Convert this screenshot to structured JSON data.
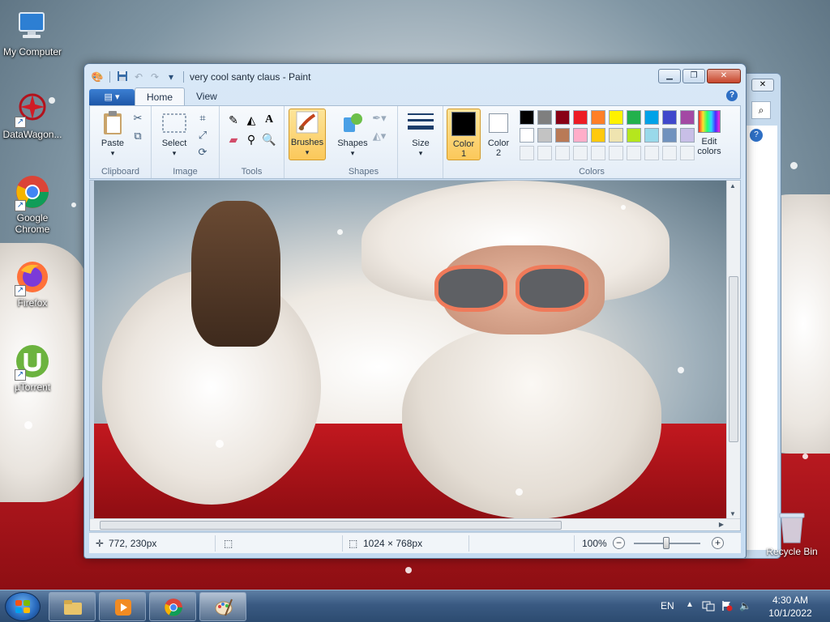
{
  "desktop": {
    "icons": [
      {
        "label": "My Computer"
      },
      {
        "label": "DataWagon..."
      },
      {
        "label": "Google Chrome"
      },
      {
        "label": "Firefox"
      },
      {
        "label": "µTorrent"
      }
    ],
    "recycle_bin": "Recycle Bin"
  },
  "window": {
    "title": "very cool santy claus - Paint",
    "tabs": [
      {
        "label": "Home"
      },
      {
        "label": "View"
      }
    ],
    "ribbon": {
      "clipboard": {
        "group": "Clipboard",
        "paste": "Paste"
      },
      "image": {
        "group": "Image",
        "select": "Select"
      },
      "tools": {
        "group": "Tools"
      },
      "brushes": "Brushes",
      "shapes": {
        "group": "Shapes",
        "shapes_btn": "Shapes"
      },
      "size": "Size",
      "colors": {
        "group": "Colors",
        "color1": "Color 1",
        "color1_num": "1",
        "color1_label": "Color",
        "color2_label": "Color",
        "color2_num": "2",
        "edit_colors_1": "Edit",
        "edit_colors_2": "colors",
        "color1_value": "#000000",
        "color2_value": "#ffffff",
        "palette_row1": [
          "#000000",
          "#7f7f7f",
          "#880015",
          "#ed1c24",
          "#ff7f27",
          "#fff200",
          "#22b14c",
          "#00a2e8",
          "#3f48cc",
          "#a349a4"
        ],
        "palette_row2": [
          "#ffffff",
          "#c3c3c3",
          "#b97a57",
          "#ffaec9",
          "#ffc90e",
          "#efe4b0",
          "#b5e61d",
          "#99d9ea",
          "#7092be",
          "#c8bfe7"
        ]
      }
    },
    "status": {
      "cursor_pos": "772, 230px",
      "image_size": "1024 × 768px",
      "zoom": "100%",
      "zoom_percent": 100
    }
  },
  "taskbar": {
    "language": "EN",
    "time": "4:30 AM",
    "date": "10/1/2022"
  }
}
